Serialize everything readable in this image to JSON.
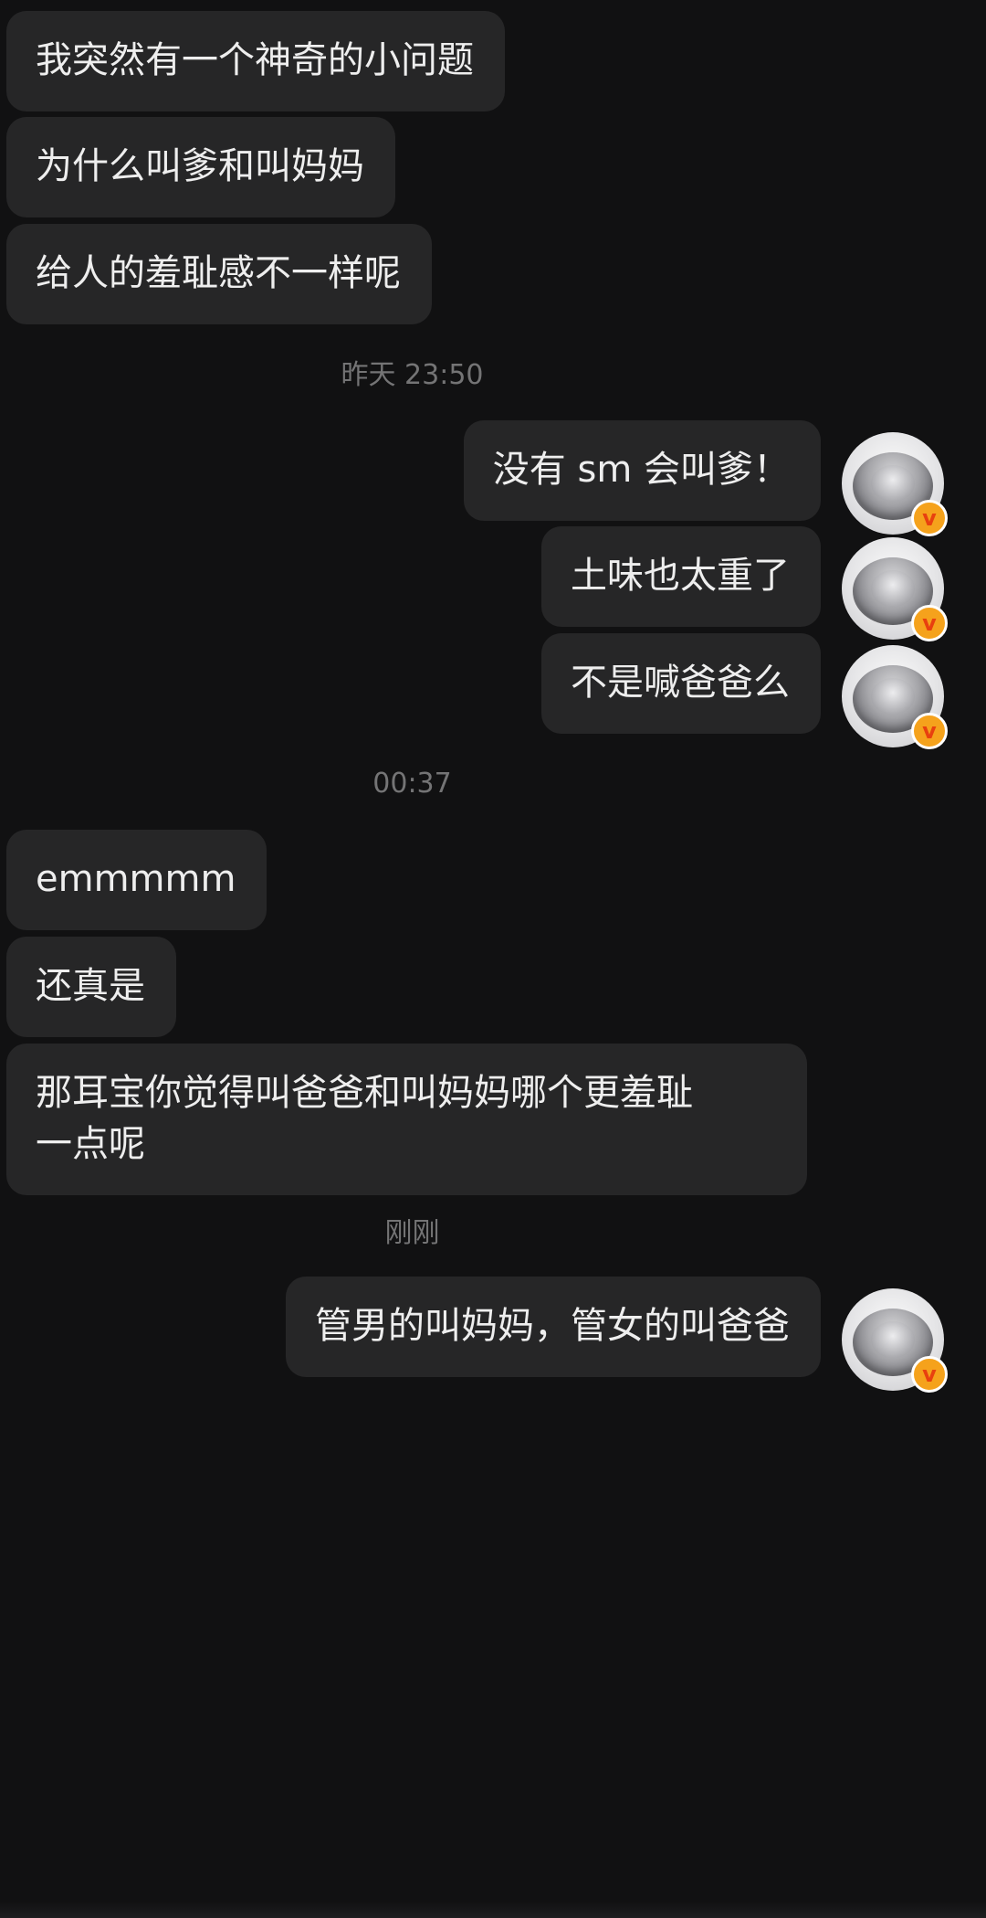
{
  "messages": [
    {
      "from": "other",
      "text": "我突然有一个神奇的小问题"
    },
    {
      "from": "other",
      "text": "为什么叫爹和叫妈妈"
    },
    {
      "from": "other",
      "text": "给人的羞耻感不一样呢"
    },
    {
      "from": "me",
      "text": "没有 sm 会叫爹！"
    },
    {
      "from": "me",
      "text": "土味也太重了"
    },
    {
      "from": "me",
      "text": "不是喊爸爸么"
    },
    {
      "from": "other",
      "text": "emmmmm"
    },
    {
      "from": "other",
      "text": "还真是"
    },
    {
      "from": "other",
      "lines": [
        "那耳宝你觉得叫爸爸和叫妈妈哪个更羞耻",
        "一点呢"
      ]
    },
    {
      "from": "me",
      "text": "管男的叫妈妈，管女的叫爸爸"
    }
  ],
  "timestamps": [
    "昨天 23:50",
    "00:37",
    "刚刚"
  ],
  "avatar": {
    "icon": "steel-bowl-avatar",
    "badge_text": "v",
    "badge_color": "#F5A21C"
  },
  "colors": {
    "background": "#111112",
    "bubble": "#262627",
    "text": "#EEEEEE",
    "timestamp": "#747475"
  }
}
